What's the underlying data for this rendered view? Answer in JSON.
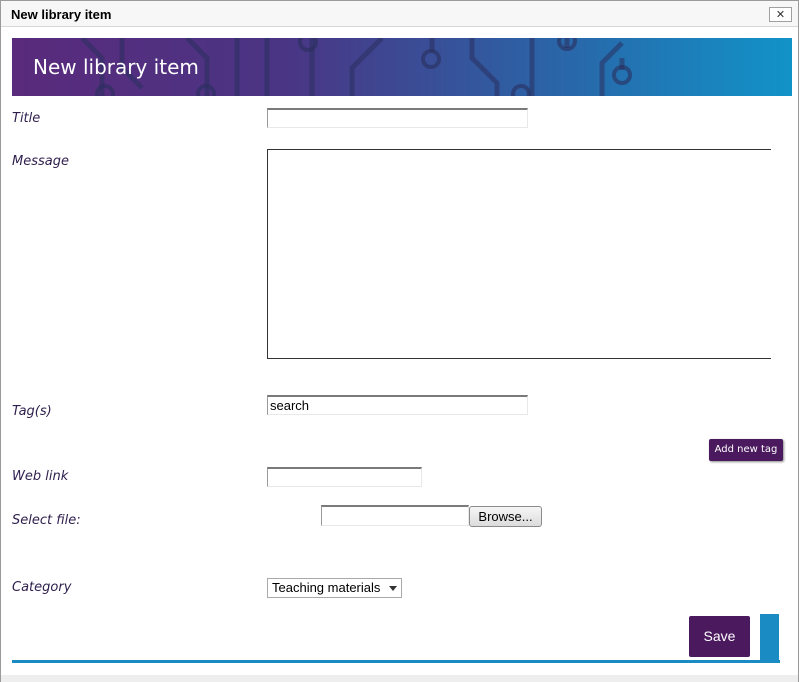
{
  "window": {
    "title": "New library item",
    "close_glyph": "✕"
  },
  "banner": {
    "title": "New library item"
  },
  "form": {
    "title_label": "Title",
    "title_value": "",
    "message_label": "Message",
    "message_value": "",
    "tags_label": "Tag(s)",
    "tags_value": "search",
    "add_tag_label": "Add new tag",
    "weblink_label": "Web link",
    "weblink_value": "",
    "file_label": "Select file:",
    "file_value": "",
    "browse_label": "Browse...",
    "category_label": "Category",
    "category_selected": "Teaching materials",
    "save_label": "Save"
  },
  "colors": {
    "accent_purple": "#4b1a5e",
    "accent_blue": "#1b8bc4",
    "label_text": "#2e1e4c"
  },
  "icons": {
    "close": "close-icon",
    "dropdown": "chevron-down-icon"
  }
}
